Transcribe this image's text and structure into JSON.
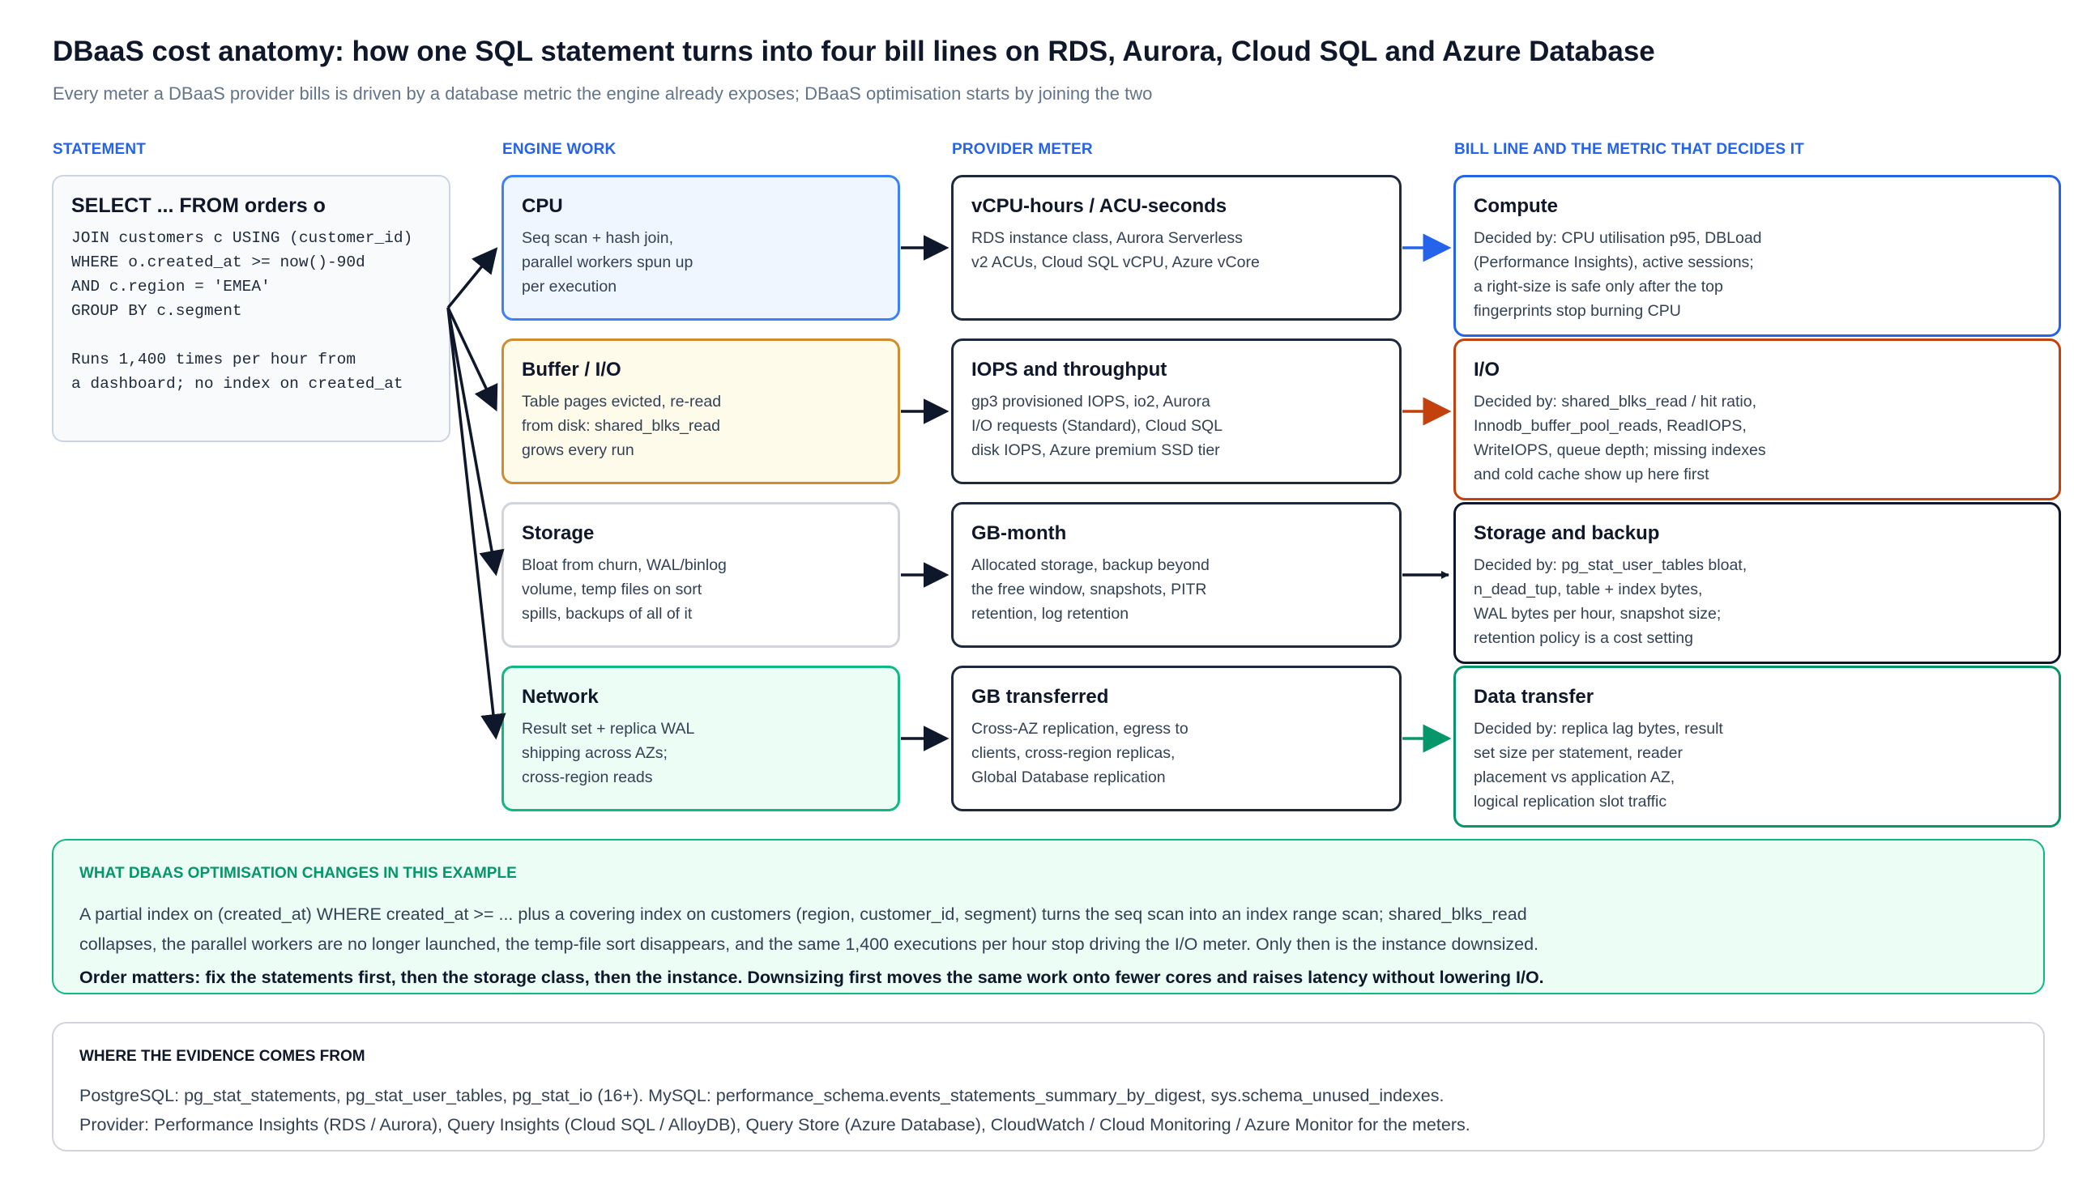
{
  "title": "DBaaS cost anatomy: how one SQL statement turns into four bill lines on RDS, Aurora, Cloud SQL and Azure Database",
  "subtitle": "Every meter a DBaaS provider bills is driven by a database metric the engine already exposes; DBaaS optimisation starts by joining the two",
  "columns": {
    "statement": "STATEMENT",
    "engine": "ENGINE WORK",
    "meter": "PROVIDER METER",
    "bill": "BILL LINE AND THE METRIC THAT DECIDES IT"
  },
  "statement": {
    "title": "SELECT ... FROM orders o",
    "code": "JOIN customers c USING (customer_id)\nWHERE o.created_at >= now()-90d\nAND c.region = 'EMEA'\nGROUP BY c.segment\n\nRuns 1,400 times per hour from\na dashboard; no index on created_at"
  },
  "engine": [
    {
      "title": "CPU",
      "body": "Seq scan + hash join,\nparallel workers spun up\nper execution"
    },
    {
      "title": "Buffer / I/O",
      "body": "Table pages evicted, re-read\nfrom disk: shared_blks_read\ngrows every run"
    },
    {
      "title": "Storage",
      "body": "Bloat from churn, WAL/binlog\nvolume, temp files on sort\nspills, backups of all of it"
    },
    {
      "title": "Network",
      "body": "Result set + replica WAL\nshipping across AZs;\ncross-region reads"
    }
  ],
  "meters": [
    {
      "title": "vCPU-hours / ACU-seconds",
      "body": "RDS instance class, Aurora Serverless\nv2 ACUs, Cloud SQL vCPU, Azure vCore"
    },
    {
      "title": "IOPS and throughput",
      "body": "gp3 provisioned IOPS, io2, Aurora\nI/O requests (Standard), Cloud SQL\ndisk IOPS, Azure premium SSD tier"
    },
    {
      "title": "GB-month",
      "body": "Allocated storage, backup beyond\nthe free window, snapshots, PITR\nretention, log retention"
    },
    {
      "title": "GB transferred",
      "body": "Cross-AZ replication, egress to\nclients, cross-region replicas,\nGlobal Database replication"
    }
  ],
  "bills": [
    {
      "title": "Compute",
      "body": "Decided by: CPU utilisation p95, DBLoad\n(Performance Insights), active sessions;\na right-size is safe only after the top\nfingerprints stop burning CPU"
    },
    {
      "title": "I/O",
      "body": "Decided by: shared_blks_read / hit ratio,\nInnodb_buffer_pool_reads, ReadIOPS,\nWriteIOPS, queue depth; missing indexes\nand cold cache show up here first"
    },
    {
      "title": "Storage and backup",
      "body": "Decided by: pg_stat_user_tables bloat,\nn_dead_tup, table + index bytes,\nWAL bytes per hour, snapshot size;\nretention policy is a cost setting"
    },
    {
      "title": "Data transfer",
      "body": "Decided by: replica lag bytes, result\nset size per statement, reader\nplacement vs application AZ,\nlogical replication slot traffic"
    }
  ],
  "optimisation": {
    "heading": "WHAT DBAAS OPTIMISATION CHANGES IN THIS EXAMPLE",
    "line1": "A partial index on (created_at) WHERE created_at >= ... plus a covering index on customers (region, customer_id, segment) turns the seq scan into an index range scan; shared_blks_read",
    "line2": "collapses, the parallel workers are no longer launched, the temp-file sort disappears, and the same 1,400 executions per hour stop driving the I/O meter. Only then is the instance downsized.",
    "line3": "Order matters: fix the statements first, then the storage class, then the instance. Downsizing first moves the same work onto fewer cores and raises latency without lowering I/O."
  },
  "evidence": {
    "heading": "WHERE THE EVIDENCE COMES FROM",
    "line1": "PostgreSQL: pg_stat_statements, pg_stat_user_tables, pg_stat_io (16+). MySQL: performance_schema.events_statements_summary_by_digest, sys.schema_unused_indexes.",
    "line2": "Provider: Performance Insights (RDS / Aurora), Query Insights (Cloud SQL / AlloyDB), Query Store (Azure Database), CloudWatch / Cloud Monitoring / Azure Monitor for the meters."
  },
  "colors": {
    "accent_blue": "#2563eb",
    "io_orange": "#c2410c",
    "transfer_green": "#059669",
    "ink": "#0f172a"
  }
}
